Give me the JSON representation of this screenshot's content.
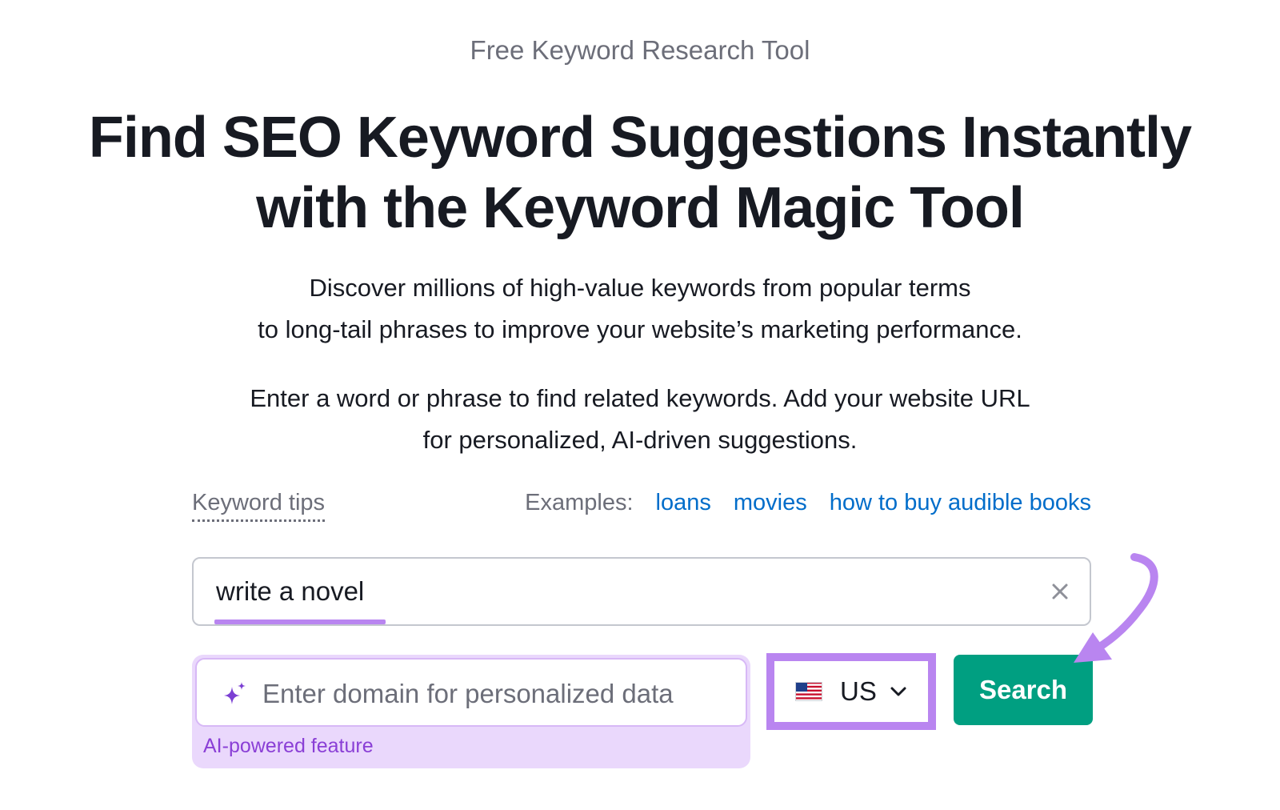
{
  "eyebrow": "Free Keyword Research Tool",
  "headline": {
    "line1": "Find SEO Keyword Suggestions Instantly",
    "line2": "with the Keyword Magic Tool"
  },
  "intro": {
    "line1": "Discover millions of high-value keywords from popular terms",
    "line2": "to long-tail phrases to improve your website’s marketing performance."
  },
  "instructions": {
    "line1": "Enter a word or phrase to find related keywords. Add your website URL",
    "line2": "for personalized, AI-driven suggestions."
  },
  "keyword_tips_label": "Keyword tips",
  "examples": {
    "label": "Examples:",
    "items": [
      "loans",
      "movies",
      "how to buy audible books"
    ]
  },
  "keyword_input": {
    "value": "write a novel"
  },
  "domain_input": {
    "placeholder": "Enter domain for personalized data",
    "badge": "AI-powered feature"
  },
  "country": {
    "code": "US"
  },
  "search_button_label": "Search",
  "colors": {
    "brand_green": "#009f81",
    "link_blue": "#006dca",
    "highlight_purple": "#b985f0",
    "ai_bg": "#ead8fc",
    "ai_text": "#8a3fd6"
  },
  "icons": {
    "clear": "close-icon",
    "sparkle": "sparkle-icon",
    "flag": "us-flag-icon",
    "dropdown": "chevron-down-icon",
    "annotation": "curved-arrow-icon"
  }
}
